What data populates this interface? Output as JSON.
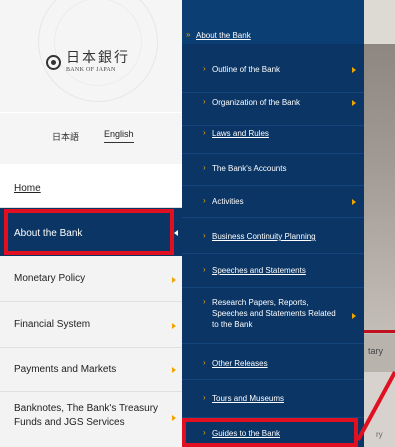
{
  "logo": {
    "jp": "日本銀行",
    "en": "BANK OF JAPAN"
  },
  "lang": {
    "japanese": "日本語",
    "english": "English"
  },
  "home": {
    "label": "Home"
  },
  "nav": {
    "about": "About the Bank",
    "monetary": "Monetary Policy",
    "financial": "Financial System",
    "payments": "Payments and Markets",
    "banknotes": "Banknotes, The Bank's Treasury Funds and JGS Services"
  },
  "panel": {
    "heading": "About the Bank",
    "items": [
      {
        "label": "Outline of the Bank",
        "underline": false,
        "has_arrow": true
      },
      {
        "label": "Organization of the Bank",
        "underline": false,
        "has_arrow": true
      },
      {
        "label": "Laws and Rules",
        "underline": true,
        "has_arrow": false
      },
      {
        "label": "The Bank's Accounts",
        "underline": false,
        "has_arrow": false
      },
      {
        "label": "Activities",
        "underline": false,
        "has_arrow": true
      },
      {
        "label": "Business Continuity Planning",
        "underline": true,
        "has_arrow": false
      },
      {
        "label": "Speeches and Statements",
        "underline": true,
        "has_arrow": false
      },
      {
        "label": "Research Papers, Reports, Speeches and Statements Related to the Bank",
        "underline": false,
        "has_arrow": true
      },
      {
        "label": "Other Releases",
        "underline": true,
        "has_arrow": false
      },
      {
        "label": "Tours and Museums",
        "underline": true,
        "has_arrow": false
      },
      {
        "label": "Guides to the Bank",
        "underline": true,
        "has_arrow": false
      }
    ]
  },
  "background": {
    "text1": "tary",
    "text2": "ry"
  },
  "colors": {
    "navy": "#0a3564",
    "accent": "#f0a400",
    "highlight": "#e01020"
  }
}
